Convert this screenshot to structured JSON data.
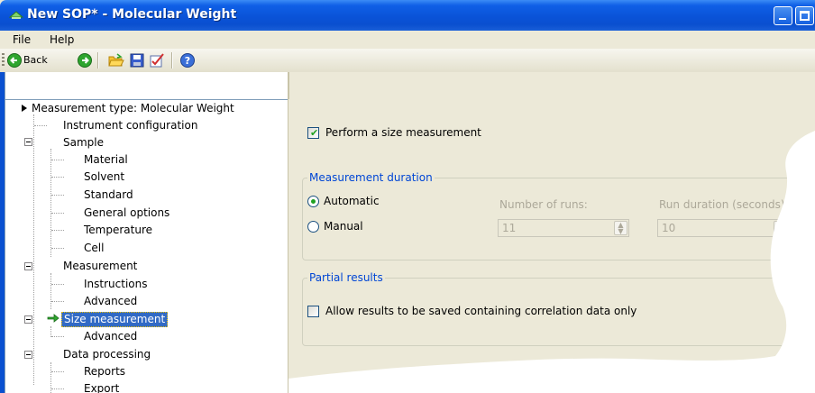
{
  "window": {
    "title": "New SOP* - Molecular Weight"
  },
  "menu": {
    "file": "File",
    "help": "Help"
  },
  "toolbar": {
    "back_label": "Back",
    "icons": [
      "back-arrow-icon",
      "forward-arrow-icon",
      "open-folder-icon",
      "save-disk-icon",
      "edit-check-icon",
      "help-icon"
    ]
  },
  "tree": {
    "items": [
      {
        "label": "Measurement type: Molecular Weight"
      },
      {
        "label": "Instrument configuration"
      },
      {
        "label": "Sample"
      },
      {
        "label": "Material"
      },
      {
        "label": "Solvent"
      },
      {
        "label": "Standard"
      },
      {
        "label": "General options"
      },
      {
        "label": "Temperature"
      },
      {
        "label": "Cell"
      },
      {
        "label": "Measurement"
      },
      {
        "label": "Instructions"
      },
      {
        "label": "Advanced"
      },
      {
        "label": "Size measurement"
      },
      {
        "label": "Advanced"
      },
      {
        "label": "Data processing"
      },
      {
        "label": "Reports"
      },
      {
        "label": "Export"
      }
    ],
    "selected_color": "#316ac5"
  },
  "content": {
    "perform_size_label": "Perform a size measurement",
    "perform_size_checked": true,
    "duration_group": "Measurement duration",
    "automatic_label": "Automatic",
    "manual_label": "Manual",
    "duration_mode": "Automatic",
    "runs_label": "Number of runs:",
    "runs_value": "11",
    "run_duration_label": "Run duration (seconds):",
    "run_duration_value": "10",
    "partial_group": "Partial results",
    "allow_label": "Allow results to be saved containing correlation data only",
    "allow_checked": false
  },
  "colors": {
    "title_bar": "#0a53d8",
    "group_title": "#0046d5",
    "check_green": "#21a121"
  }
}
